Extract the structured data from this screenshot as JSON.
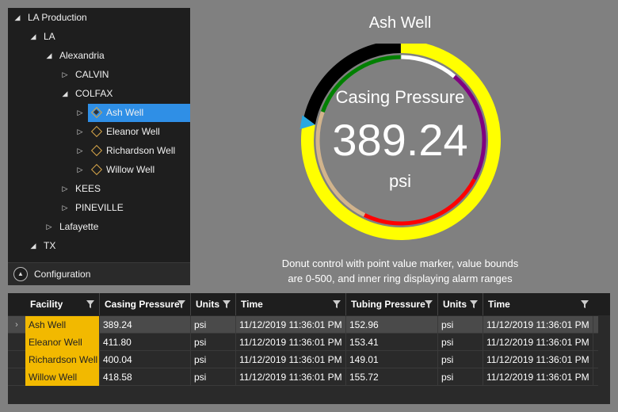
{
  "tree": {
    "items": [
      {
        "label": "LA Production",
        "arrow": "◢",
        "level": 0
      },
      {
        "label": "LA",
        "arrow": "◢",
        "level": 1
      },
      {
        "label": "Alexandria",
        "arrow": "◢",
        "level": 2
      },
      {
        "label": "CALVIN",
        "arrow": "▷",
        "level": 3
      },
      {
        "label": "COLFAX",
        "arrow": "◢",
        "level": 3
      },
      {
        "label": "Ash Well",
        "arrow": "▷",
        "level": 4,
        "icon": "well-icon",
        "selected": true
      },
      {
        "label": "Eleanor Well",
        "arrow": "▷",
        "level": 4,
        "icon": "well-icon"
      },
      {
        "label": "Richardson Well",
        "arrow": "▷",
        "level": 4,
        "icon": "well-icon"
      },
      {
        "label": "Willow Well",
        "arrow": "▷",
        "level": 4,
        "icon": "well-icon"
      },
      {
        "label": "KEES",
        "arrow": "▷",
        "level": 3
      },
      {
        "label": "PINEVILLE",
        "arrow": "▷",
        "level": 3
      },
      {
        "label": "Lafayette",
        "arrow": "▷",
        "level": 2
      },
      {
        "label": "TX",
        "arrow": "◢",
        "level": 1
      }
    ],
    "config_label": "Configuration"
  },
  "gauge": {
    "title": "Ash Well",
    "label": "Casing Pressure",
    "value_text": "389.24",
    "value": 389.24,
    "min": 0,
    "max": 500,
    "units": "psi",
    "caption_line1": "Donut control with point value marker, value bounds",
    "caption_line2": "are 0-500, and inner ring displaying alarm ranges",
    "colors": {
      "outer_ring": "#ffff00",
      "outer_ring_empty": "#000000",
      "inner_ranges": [
        "#ffff00",
        "#d2b48c",
        "#ff0000",
        "#800080",
        "#ffffff",
        "#008000"
      ],
      "marker": "#29a8e0"
    }
  },
  "grid": {
    "columns": [
      "Facility",
      "Casing Pressure",
      "Units",
      "Time",
      "Tubing Pressure",
      "Units",
      "Time"
    ],
    "rows": [
      [
        "Ash Well",
        "389.24",
        "psi",
        "11/12/2019 11:36:01 PM",
        "152.96",
        "psi",
        "11/12/2019 11:36:01 PM"
      ],
      [
        "Eleanor Well",
        "411.80",
        "psi",
        "11/12/2019 11:36:01 PM",
        "153.41",
        "psi",
        "11/12/2019 11:36:01 PM"
      ],
      [
        "Richardson Well",
        "400.04",
        "psi",
        "11/12/2019 11:36:01 PM",
        "149.01",
        "psi",
        "11/12/2019 11:36:01 PM"
      ],
      [
        "Willow Well",
        "418.58",
        "psi",
        "11/12/2019 11:36:01 PM",
        "155.72",
        "psi",
        "11/12/2019 11:36:01 PM"
      ]
    ],
    "row_indicator": "›"
  }
}
